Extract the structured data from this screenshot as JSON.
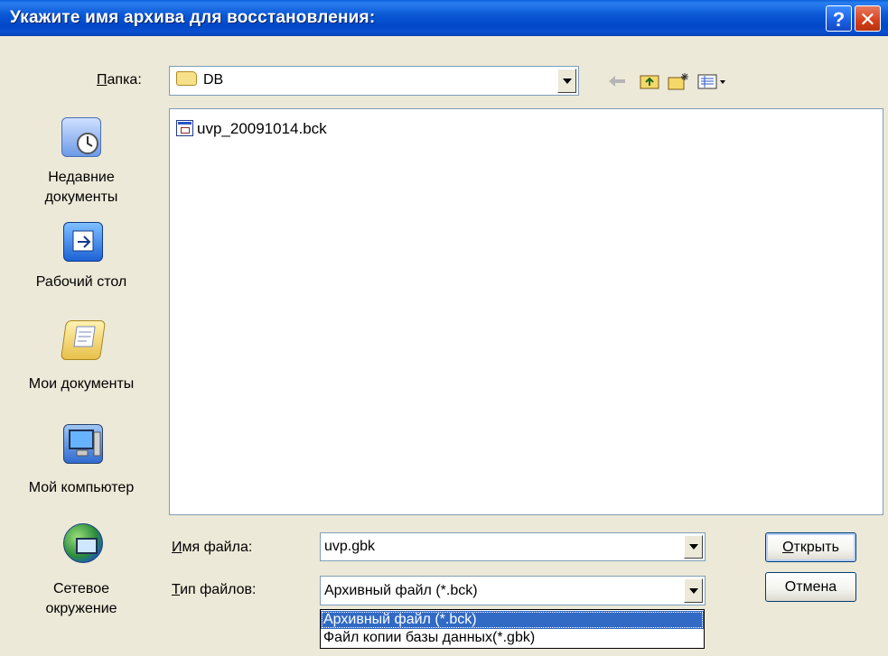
{
  "window": {
    "title": "Укажите имя архива для восстановления:",
    "help_label": "?",
    "close_label": "✕"
  },
  "toolbar": {
    "folder_label": "Папка:",
    "folder_value": "DB",
    "icons": [
      "back-arrow-icon",
      "up-folder-icon",
      "new-folder-icon",
      "view-menu-icon"
    ]
  },
  "places": [
    {
      "label": "Недавние\nдокументы",
      "icon": "recent-documents-icon"
    },
    {
      "label": "Рабочий стол",
      "icon": "desktop-icon"
    },
    {
      "label": "Мои документы",
      "icon": "my-documents-icon"
    },
    {
      "label": "Мой компьютер",
      "icon": "my-computer-icon"
    },
    {
      "label": "Сетевое\nокружение",
      "icon": "network-icon"
    }
  ],
  "files": [
    {
      "name": "uvp_20091014.bck"
    }
  ],
  "form": {
    "filename_label": "Имя файла:",
    "filename_value": "uvp.gbk",
    "filetype_label": "Тип файлов:",
    "filetype_value": "Архивный файл (*.bck)",
    "filetype_options": [
      "Архивный файл (*.bck)",
      "Файл копии базы данных(*.gbk)"
    ],
    "open_button": "Открыть",
    "cancel_button": "Отмена"
  },
  "colors": {
    "titlebar": "#0054e3",
    "selection": "#316ac5",
    "dialog_bg": "#ece9d8"
  }
}
